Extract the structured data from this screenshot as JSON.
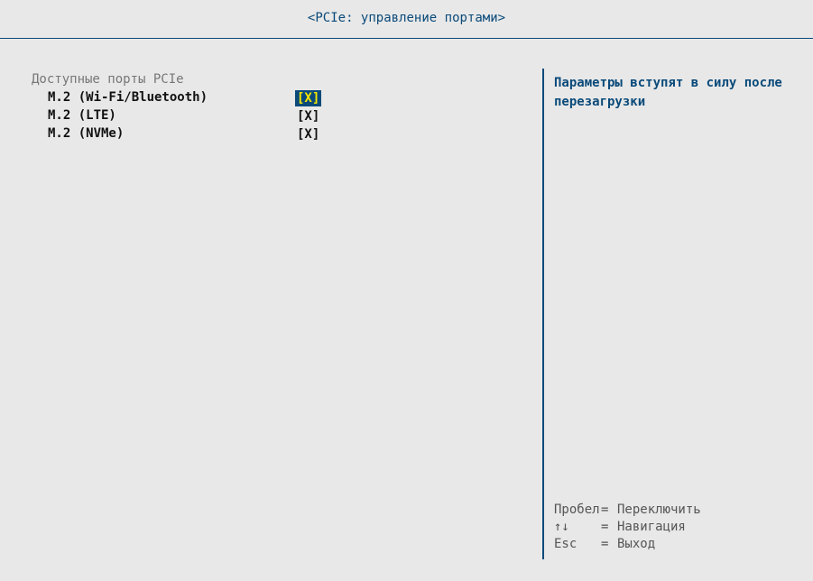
{
  "header": {
    "title": "<PCIe: управление портами>"
  },
  "ports_section": {
    "heading": "Доступные порты PCIe",
    "items": [
      {
        "label": "M.2 (Wi-Fi/Bluetooth)",
        "value": "[X]",
        "selected": true
      },
      {
        "label": "M.2 (LTE)",
        "value": "[X]",
        "selected": false
      },
      {
        "label": "M.2 (NVMe)",
        "value": "[X]",
        "selected": false
      }
    ]
  },
  "help_panel": {
    "text": "Параметры вступят в силу после перезагрузки"
  },
  "key_hints": [
    {
      "key": "Пробел",
      "eq": "=",
      "action": "Переключить"
    },
    {
      "key": "↑↓",
      "eq": "=",
      "action": "Навигация"
    },
    {
      "key": "Esc",
      "eq": "=",
      "action": "Выход"
    }
  ],
  "colors": {
    "background": "#e8e8e8",
    "accent": "#0a4a7a",
    "selection_text": "#f7e600",
    "heading_gray": "#777777"
  }
}
